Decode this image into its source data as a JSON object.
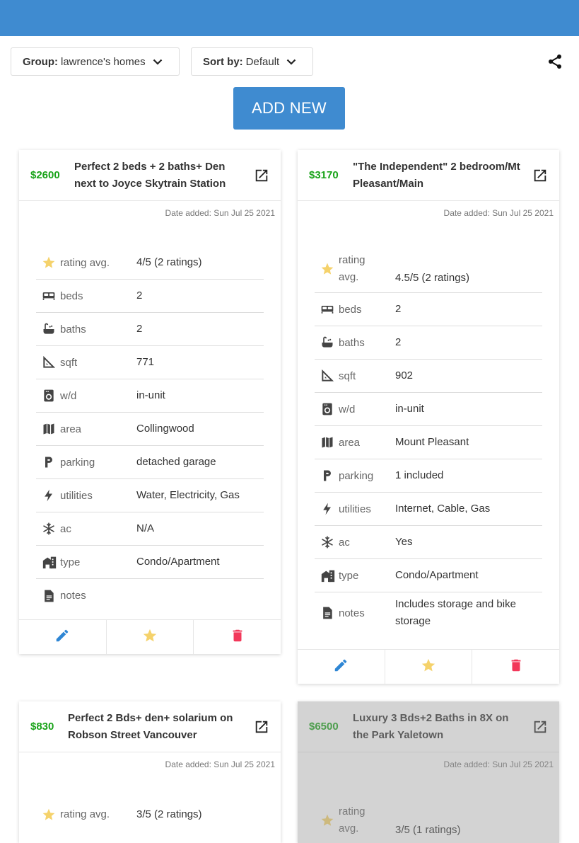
{
  "header": {},
  "controls": {
    "group_label": "Group:",
    "group_value": "lawrence's homes",
    "sort_label": "Sort by:",
    "sort_value": "Default",
    "add_new": "ADD NEW"
  },
  "colors": {
    "primary": "#3f8bd0",
    "price": "#19a319",
    "star": "#f5c242",
    "delete": "#f2385a",
    "edit": "#2e86d4"
  },
  "listings": [
    {
      "price": "$2600",
      "title": "Perfect 2 beds + 2 baths+ Den next to Joyce Skytrain Station",
      "date": "Date added: Sun Jul 25 2021",
      "rows": [
        {
          "icon": "star-icon",
          "label": "rating avg.",
          "value": "4/5 (2 ratings)"
        },
        {
          "icon": "bed-icon",
          "label": "beds",
          "value": "2"
        },
        {
          "icon": "bathtub-icon",
          "label": "baths",
          "value": "2"
        },
        {
          "icon": "ruler-icon",
          "label": "sqft",
          "value": "771"
        },
        {
          "icon": "washer-icon",
          "label": "w/d",
          "value": "in-unit"
        },
        {
          "icon": "map-icon",
          "label": "area",
          "value": "Collingwood"
        },
        {
          "icon": "parking-icon",
          "label": "parking",
          "value": "detached garage"
        },
        {
          "icon": "bolt-icon",
          "label": "utilities",
          "value": "Water, Electricity, Gas"
        },
        {
          "icon": "snowflake-icon",
          "label": "ac",
          "value": "N/A"
        },
        {
          "icon": "building-icon",
          "label": "type",
          "value": "Condo/Apartment"
        },
        {
          "icon": "notes-icon",
          "label": "notes",
          "value": ""
        }
      ]
    },
    {
      "price": "$3170",
      "title": "\"The Independent\" 2 bedroom/Mt Pleasant/Main",
      "date": "Date added: Sun Jul 25 2021",
      "rows": [
        {
          "icon": "star-icon",
          "label": "rating avg.",
          "value": "4.5/5 (2 ratings)"
        },
        {
          "icon": "bed-icon",
          "label": "beds",
          "value": "2"
        },
        {
          "icon": "bathtub-icon",
          "label": "baths",
          "value": "2"
        },
        {
          "icon": "ruler-icon",
          "label": "sqft",
          "value": "902"
        },
        {
          "icon": "washer-icon",
          "label": "w/d",
          "value": "in-unit"
        },
        {
          "icon": "map-icon",
          "label": "area",
          "value": "Mount Pleasant"
        },
        {
          "icon": "parking-icon",
          "label": "parking",
          "value": "1 included"
        },
        {
          "icon": "bolt-icon",
          "label": "utilities",
          "value": "Internet, Cable, Gas"
        },
        {
          "icon": "snowflake-icon",
          "label": "ac",
          "value": "Yes"
        },
        {
          "icon": "building-icon",
          "label": "type",
          "value": "Condo/Apartment"
        },
        {
          "icon": "notes-icon",
          "label": "notes",
          "value": "Includes storage and bike storage"
        }
      ]
    },
    {
      "price": "$830",
      "title": "Perfect 2 Bds+ den+ solarium on Robson Street Vancouver",
      "date": "Date added: Sun Jul 25 2021",
      "rows": [
        {
          "icon": "star-icon",
          "label": "rating avg.",
          "value": "3/5 (2 ratings)"
        }
      ]
    },
    {
      "price": "$6500",
      "title": "Luxury 3 Bds+2 Baths in 8X on the Park Yaletown",
      "date": "Date added: Sun Jul 25 2021",
      "rows": [
        {
          "icon": "star-icon",
          "label": "rating avg.",
          "value": "3/5 (1 ratings)"
        }
      ]
    }
  ]
}
